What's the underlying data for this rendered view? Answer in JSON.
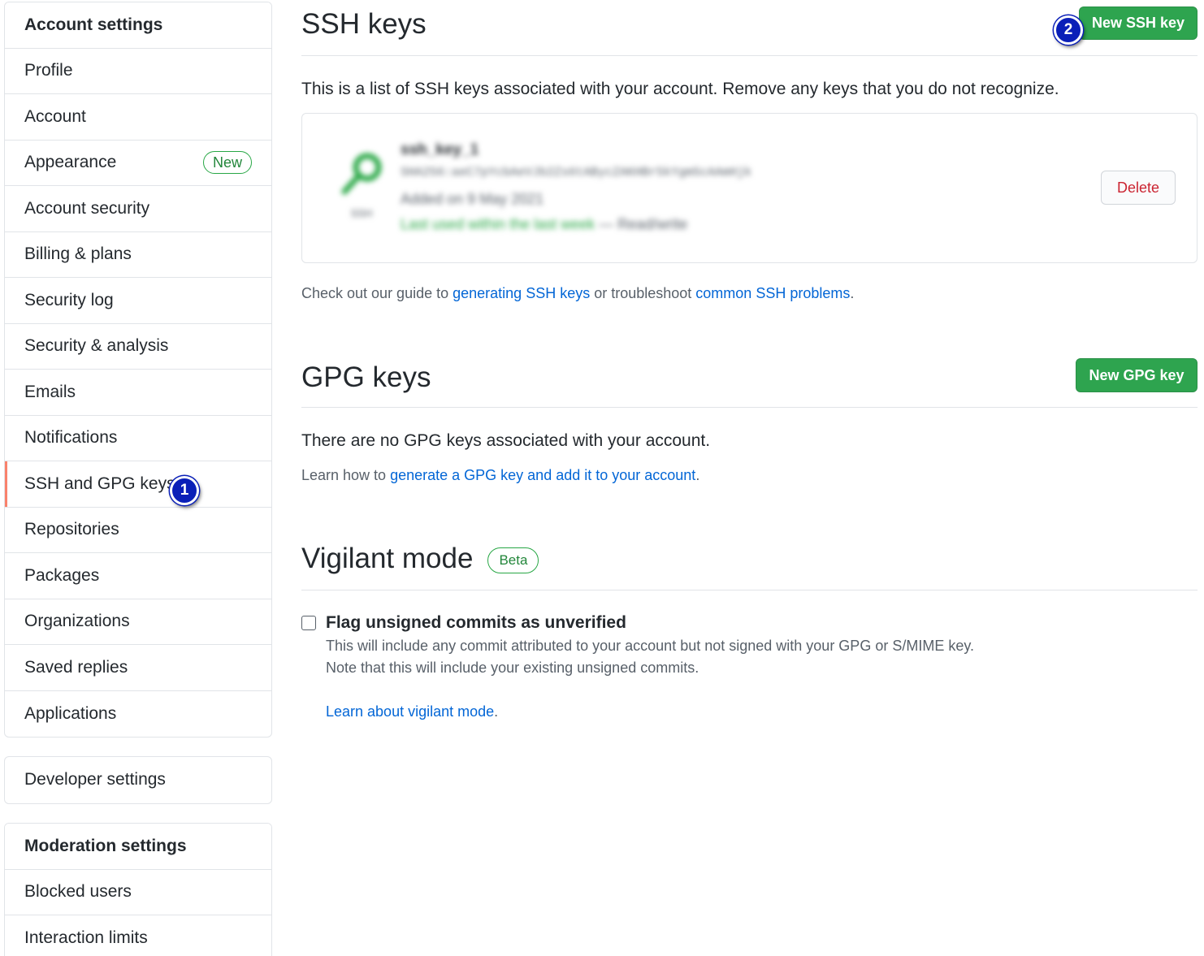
{
  "sidebar": {
    "account_header": "Account settings",
    "items": [
      {
        "label": "Profile"
      },
      {
        "label": "Account"
      },
      {
        "label": "Appearance",
        "badge": "New"
      },
      {
        "label": "Account security"
      },
      {
        "label": "Billing & plans"
      },
      {
        "label": "Security log"
      },
      {
        "label": "Security & analysis"
      },
      {
        "label": "Emails"
      },
      {
        "label": "Notifications"
      },
      {
        "label": "SSH and GPG keys",
        "selected": true
      },
      {
        "label": "Repositories"
      },
      {
        "label": "Packages"
      },
      {
        "label": "Organizations"
      },
      {
        "label": "Saved replies"
      },
      {
        "label": "Applications"
      }
    ],
    "developer_settings": "Developer settings",
    "moderation_header": "Moderation settings",
    "moderation_items": [
      {
        "label": "Blocked users"
      },
      {
        "label": "Interaction limits"
      }
    ]
  },
  "markers": {
    "one": "1",
    "two": "2"
  },
  "ssh": {
    "title": "SSH keys",
    "new_button": "New SSH key",
    "description": "This is a list of SSH keys associated with your account. Remove any keys that you do not recognize.",
    "key": {
      "name": "ssh_key_1",
      "fingerprint": "SHA256:aeC7pYcbAeVJb2Zs6tABycZAKHBr5kYgm5cAAmHjk",
      "added": "Added on 9 May 2021",
      "last_used": "Last used within the last week",
      "access": "Read/write",
      "icon_label": "SSH",
      "delete_label": "Delete"
    },
    "guide_prefix": "Check out our guide to ",
    "guide_link1": "generating SSH keys",
    "guide_middle": " or troubleshoot ",
    "guide_link2": "common SSH problems",
    "guide_suffix": "."
  },
  "gpg": {
    "title": "GPG keys",
    "new_button": "New GPG key",
    "empty_text": "There are no GPG keys associated with your account.",
    "learn_prefix": "Learn how to ",
    "learn_link": "generate a GPG key and add it to your account",
    "learn_suffix": "."
  },
  "vigilant": {
    "title": "Vigilant mode",
    "badge": "Beta",
    "checkbox_label": "Flag unsigned commits as unverified",
    "note1": "This will include any commit attributed to your account but not signed with your GPG or S/MIME key.",
    "note2": "Note that this will include your existing unsigned commits.",
    "learn_link": "Learn about vigilant mode",
    "learn_suffix": "."
  },
  "colors": {
    "accent_green": "#2ea44f",
    "link_blue": "#0366d6",
    "danger_red": "#cb2431",
    "selected_bar": "#f9826c",
    "marker_blue": "#0a1fb8"
  }
}
